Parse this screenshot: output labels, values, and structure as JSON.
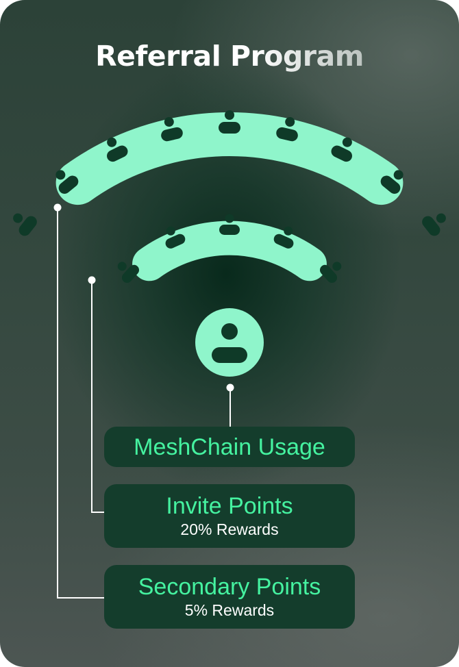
{
  "title": "Referral Program",
  "colors": {
    "accent_green": "#45f2a0",
    "shape_mint": "#8ff5cb",
    "pill_bg": "#143d2c",
    "person_dark": "#0f3a28"
  },
  "diagram": {
    "center_icon": "user-icon",
    "arc_icon": "user-icon",
    "inner_arc_user_count": 5,
    "outer_arc_user_count": 9
  },
  "labels": {
    "usage": {
      "title": "MeshChain Usage"
    },
    "invite": {
      "title": "Invite Points",
      "reward": "20% Rewards"
    },
    "secondary": {
      "title": "Secondary Points",
      "reward": "5% Rewards"
    }
  }
}
